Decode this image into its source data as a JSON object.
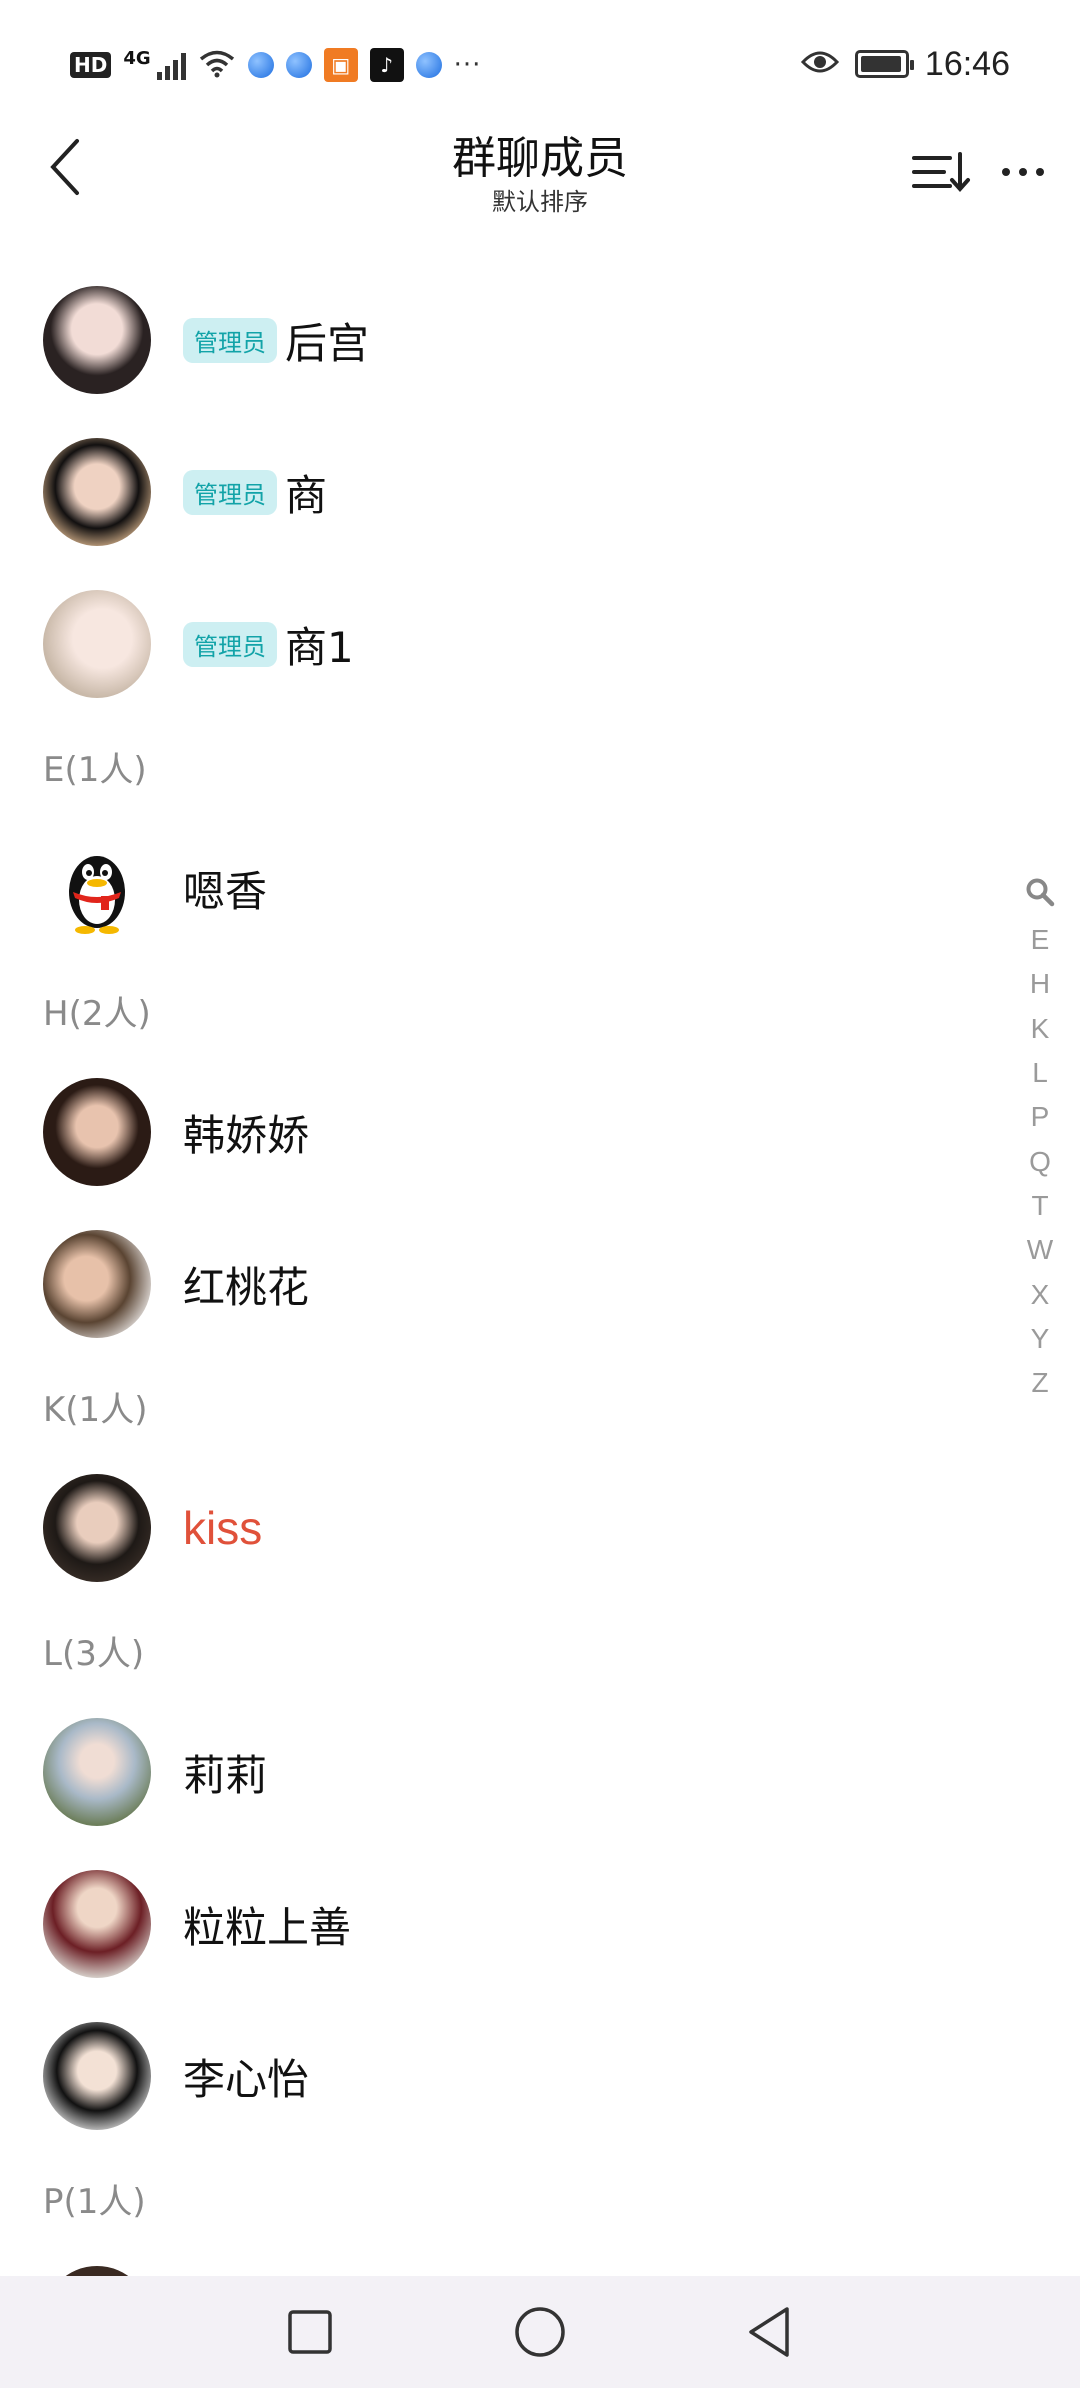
{
  "status_bar": {
    "network_hd": "HD",
    "network_type": "4G",
    "notifications_more": "···",
    "time": "16:46",
    "icons": [
      "hd-icon",
      "signal-icon",
      "wifi-icon",
      "browser-app-icon",
      "browser-app-icon",
      "gift-app-icon",
      "tiktok-app-icon",
      "browser-app-icon",
      "eye-icon",
      "battery-icon"
    ]
  },
  "header": {
    "title": "群聊成员",
    "subtitle": "默认排序"
  },
  "badge_label": "管理员",
  "admins": [
    {
      "name": "后宫"
    },
    {
      "name": "商"
    },
    {
      "name": "商1"
    }
  ],
  "sections": [
    {
      "header": "E(1人)",
      "members": [
        {
          "name": "嗯香"
        }
      ]
    },
    {
      "header": "H(2人)",
      "members": [
        {
          "name": "韩娇娇"
        },
        {
          "name": "红桃花"
        }
      ]
    },
    {
      "header": "K(1人)",
      "members": [
        {
          "name": "kiss",
          "color": "#e0513a"
        }
      ]
    },
    {
      "header": "L(3人)",
      "members": [
        {
          "name": "莉莉"
        },
        {
          "name": "粒粒上善"
        },
        {
          "name": "李心怡"
        }
      ]
    },
    {
      "header": "P(1人)",
      "members": []
    }
  ],
  "index_letters": [
    "E",
    "H",
    "K",
    "L",
    "P",
    "Q",
    "T",
    "W",
    "X",
    "Y",
    "Z"
  ],
  "colors": {
    "badge_bg": "#cdeff2",
    "badge_text": "#12a3a8",
    "highlight_name": "#e0513a",
    "section_text": "#8a8a8a"
  }
}
